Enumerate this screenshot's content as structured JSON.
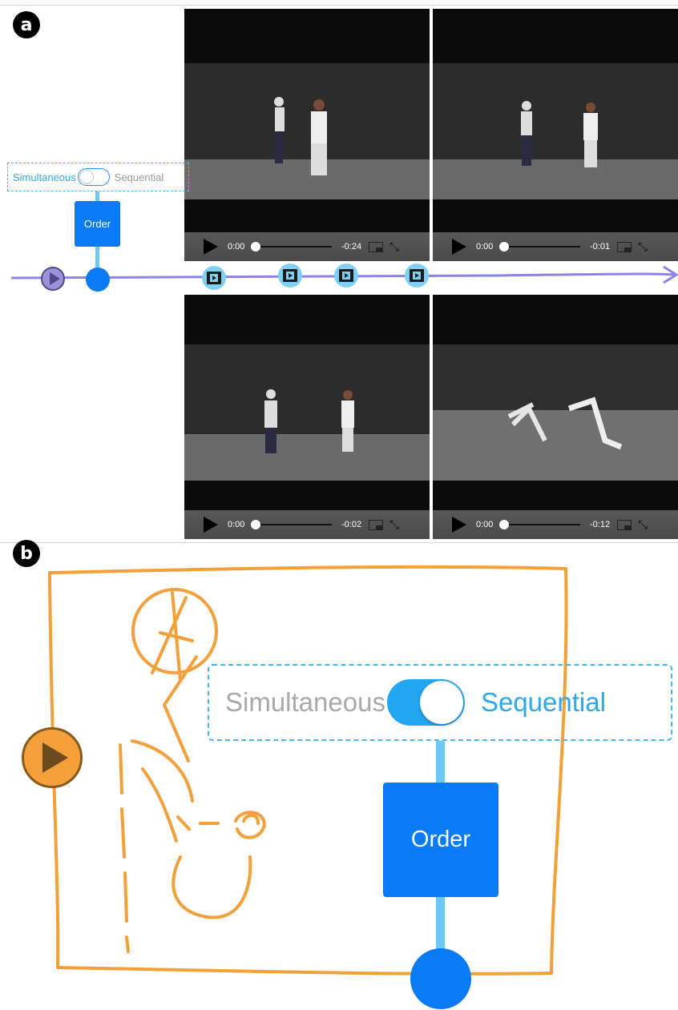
{
  "panels": {
    "a_label": "a",
    "b_label": "b"
  },
  "toggle": {
    "simultaneous_label": "Simultaneous",
    "sequential_label": "Sequential",
    "state": "sequential",
    "order_label": "Order"
  },
  "colors": {
    "accent_blue": "#0a7af5",
    "toggle_blue": "#22a6f2",
    "dashed_outline": "#4ab6ec",
    "timeline_purple": "#8b84e8",
    "sketch_orange": "#f3a03a"
  },
  "timeline": {
    "play_icon": "play-icon",
    "clip_icon": "film-clip-icon",
    "clip_count": 4
  },
  "videos": [
    {
      "time_elapsed": "0:00",
      "time_remaining": "-0:24"
    },
    {
      "time_elapsed": "0:00",
      "time_remaining": "-0:01"
    },
    {
      "time_elapsed": "0:00",
      "time_remaining": "-0:02"
    },
    {
      "time_elapsed": "0:00",
      "time_remaining": "-0:12"
    }
  ]
}
